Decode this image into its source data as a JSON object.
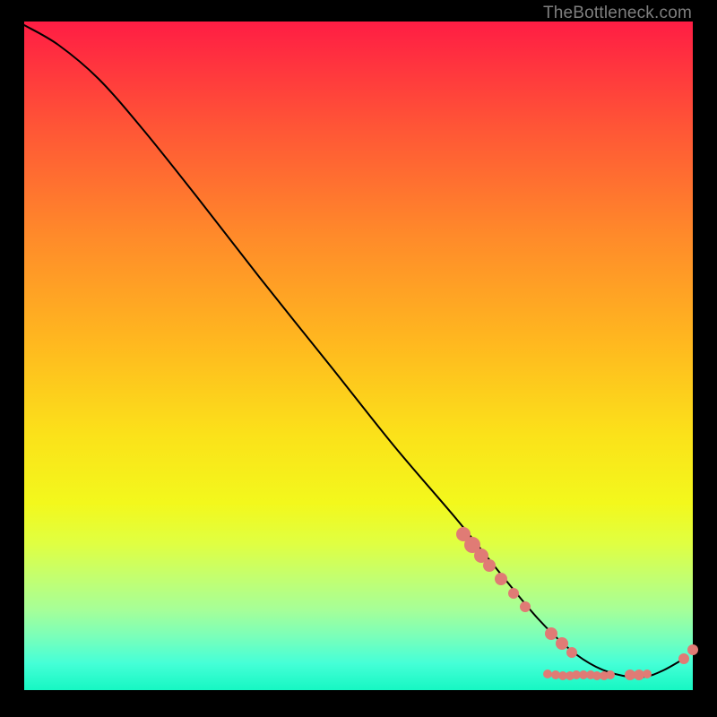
{
  "attribution": "TheBottleneck.com",
  "colors": {
    "dot_fill": "#e07b75",
    "dot_outline": "#d86a63",
    "curve": "#000000"
  },
  "chart_data": {
    "type": "line",
    "title": "",
    "xlabel": "",
    "ylabel": "",
    "xlim": [
      27,
      773
    ],
    "ylim": [
      24,
      770
    ],
    "grid": false,
    "legend": false,
    "curve_points": [
      [
        27,
        28
      ],
      [
        65,
        50
      ],
      [
        110,
        88
      ],
      [
        160,
        145
      ],
      [
        220,
        220
      ],
      [
        290,
        310
      ],
      [
        370,
        410
      ],
      [
        440,
        498
      ],
      [
        510,
        580
      ],
      [
        560,
        642
      ],
      [
        600,
        690
      ],
      [
        635,
        724
      ],
      [
        665,
        744
      ],
      [
        695,
        754
      ],
      [
        720,
        755
      ],
      [
        740,
        748
      ],
      [
        763,
        735
      ]
    ],
    "dots": [
      {
        "x": 517,
        "y": 596,
        "r": 8
      },
      {
        "x": 527,
        "y": 608,
        "r": 9
      },
      {
        "x": 537,
        "y": 620,
        "r": 8
      },
      {
        "x": 546,
        "y": 631,
        "r": 7
      },
      {
        "x": 559,
        "y": 646,
        "r": 7
      },
      {
        "x": 573,
        "y": 662,
        "r": 6
      },
      {
        "x": 586,
        "y": 677,
        "r": 6
      },
      {
        "x": 615,
        "y": 707,
        "r": 7
      },
      {
        "x": 627,
        "y": 718,
        "r": 7
      },
      {
        "x": 638,
        "y": 728,
        "r": 6
      },
      {
        "x": 611,
        "y": 752,
        "r": 5
      },
      {
        "x": 620,
        "y": 753,
        "r": 5
      },
      {
        "x": 628,
        "y": 754,
        "r": 5
      },
      {
        "x": 636,
        "y": 754,
        "r": 5
      },
      {
        "x": 643,
        "y": 753,
        "r": 5
      },
      {
        "x": 651,
        "y": 753,
        "r": 5
      },
      {
        "x": 659,
        "y": 753,
        "r": 5
      },
      {
        "x": 666,
        "y": 754,
        "r": 5
      },
      {
        "x": 674,
        "y": 754,
        "r": 5
      },
      {
        "x": 681,
        "y": 753,
        "r": 5
      },
      {
        "x": 703,
        "y": 753,
        "r": 6
      },
      {
        "x": 713,
        "y": 753,
        "r": 6
      },
      {
        "x": 722,
        "y": 752,
        "r": 5
      },
      {
        "x": 763,
        "y": 735,
        "r": 6
      },
      {
        "x": 773,
        "y": 725,
        "r": 6
      }
    ]
  }
}
